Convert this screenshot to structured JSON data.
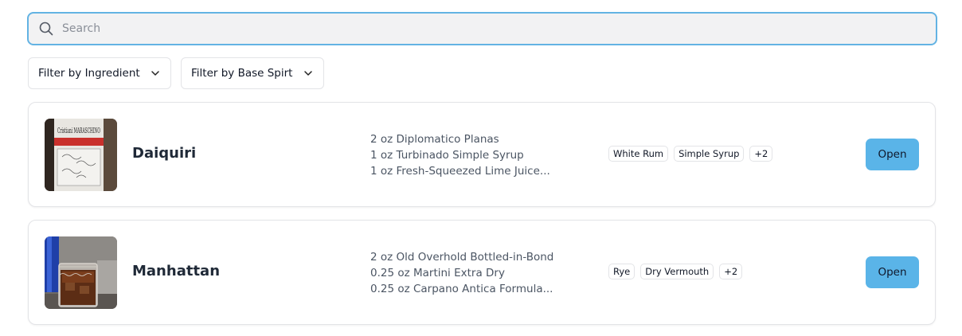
{
  "search": {
    "placeholder": "Search",
    "value": ""
  },
  "filters": {
    "ingredient_label": "Filter by Ingredient",
    "base_spirit_label": "Filter by Base Spirt"
  },
  "cocktails": [
    {
      "name": "Daiquiri",
      "ingredients": [
        "2 oz Diplomatico Planas",
        "1 oz Turbinado Simple Syrup",
        "1 oz Fresh-Squeezed Lime Juice..."
      ],
      "tags": [
        "White Rum",
        "Simple Syrup",
        "+2"
      ],
      "open_label": "Open",
      "image_label": "Cristiani MARASCHINO"
    },
    {
      "name": "Manhattan",
      "ingredients": [
        "2 oz Old Overhold Bottled-in-Bond",
        "0.25 oz Martini Extra Dry",
        "0.25 oz Carpano Antica Formula..."
      ],
      "tags": [
        "Rye",
        "Dry Vermouth",
        "+2"
      ],
      "open_label": "Open"
    }
  ],
  "colors": {
    "accent": "#5ab4e8",
    "search_border": "#63b3e3",
    "search_bg": "#f2f2f3",
    "card_border": "#e3e4e7"
  },
  "icons": {
    "search": "search-icon",
    "dropdown": "chevron-down-icon"
  }
}
